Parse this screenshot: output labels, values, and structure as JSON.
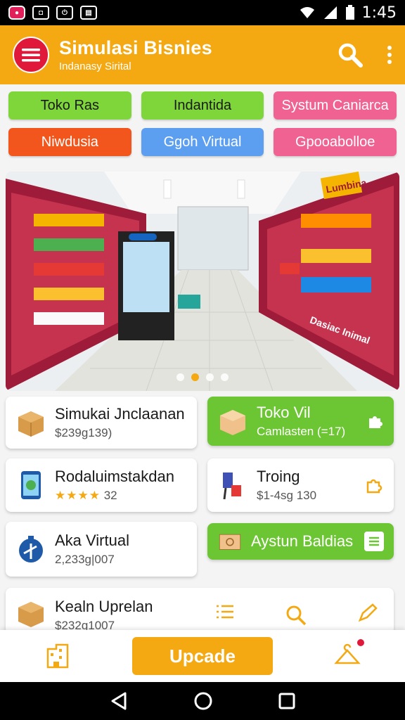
{
  "status": {
    "time": "1:45",
    "icons": [
      "record-icon",
      "screen-icon",
      "power-icon",
      "sim-icon"
    ]
  },
  "appbar": {
    "title": "Simulasi Bisnies",
    "subtitle": "Indanasy Sirital"
  },
  "chips": [
    {
      "label": "Toko Ras",
      "color": "#7ed63a"
    },
    {
      "label": "Indantida",
      "color": "#7ed63a"
    },
    {
      "label": "Systum Caniarca",
      "color": "#f06292"
    },
    {
      "label": "Niwdusia",
      "color": "#f2561d"
    },
    {
      "label": "Ggoh Virtual",
      "color": "#5c9ff0"
    },
    {
      "label": "Gpooabolloe",
      "color": "#f06292"
    }
  ],
  "banner": {
    "sign_top": "Lumbina",
    "sign_side": "Dasiac Inimal",
    "slides": 4,
    "active_slide": 2
  },
  "cards": [
    {
      "title": "Simukai Jnclaanan",
      "sub": "$239g139)",
      "icon": "box-icon"
    },
    {
      "title": "Toko Vil",
      "sub": "Camlasten (=17)",
      "icon": "box-icon",
      "trail": "puzzle-icon"
    },
    {
      "title": "Rodaluimstakdan",
      "stars": "★★★★",
      "rating": "32",
      "icon": "phone-icon"
    },
    {
      "title": "Troing",
      "sub": "$1-4sg 130",
      "icon": "shopper-icon",
      "trail": "puzzle-icon"
    },
    {
      "title": "Aka Virtual",
      "sub": "2,233g|007",
      "icon": "globe-icon"
    },
    {
      "title": "Aystun Baldias",
      "icon": "cash-icon",
      "trail": "list-icon"
    },
    {
      "title": "Kealn Uprelan",
      "sub": "$232g1007",
      "icon": "box-icon"
    }
  ],
  "bottom": {
    "upgrade_label": "Upcade"
  }
}
